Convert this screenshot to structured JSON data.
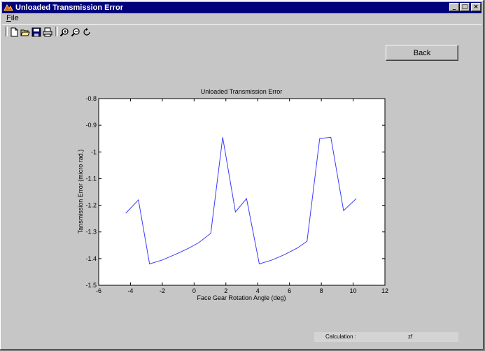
{
  "window": {
    "title": "Unloaded Transmission Error",
    "controls": {
      "minimize": "_",
      "maximize": "□",
      "close": "×"
    }
  },
  "menu": {
    "file": "File"
  },
  "toolbar": {
    "icons": [
      "new-icon",
      "open-icon",
      "save-icon",
      "print-icon",
      "zoom-in-icon",
      "zoom-out-icon",
      "rotate-icon"
    ]
  },
  "buttons": {
    "back": "Back"
  },
  "status": {
    "label": "Calculation :",
    "value": "zf"
  },
  "colors": {
    "title_bar": "#00007b",
    "line": "#3a3aff",
    "window_bg": "#c6c6c6"
  },
  "chart_data": {
    "type": "line",
    "title": "Unloaded Transmission Error",
    "xlabel": "Face Gear Rotation Angle (deg)",
    "ylabel": "Tansmission Error (micro rad.)",
    "xlim": [
      -6,
      12
    ],
    "ylim": [
      -1.5,
      -0.8
    ],
    "xticks": [
      -6,
      -4,
      -2,
      0,
      2,
      4,
      6,
      8,
      10,
      12
    ],
    "yticks": [
      -0.8,
      -0.9,
      -1,
      -1.1,
      -1.2,
      -1.3,
      -1.4,
      -1.5
    ],
    "series": [
      {
        "x": [
          -4.3,
          -3.5,
          -2.8,
          -2.0,
          -1.2,
          -0.3,
          0.3,
          1.05,
          1.8,
          2.6,
          3.3,
          4.1,
          4.9,
          5.7,
          6.5,
          7.1,
          7.9,
          8.6,
          9.4,
          10.2
        ],
        "y": [
          -1.23,
          -1.18,
          -1.42,
          -1.405,
          -1.385,
          -1.36,
          -1.34,
          -1.305,
          -0.945,
          -1.225,
          -1.175,
          -1.42,
          -1.405,
          -1.385,
          -1.36,
          -1.335,
          -0.95,
          -0.945,
          -1.22,
          -1.175
        ]
      }
    ]
  }
}
